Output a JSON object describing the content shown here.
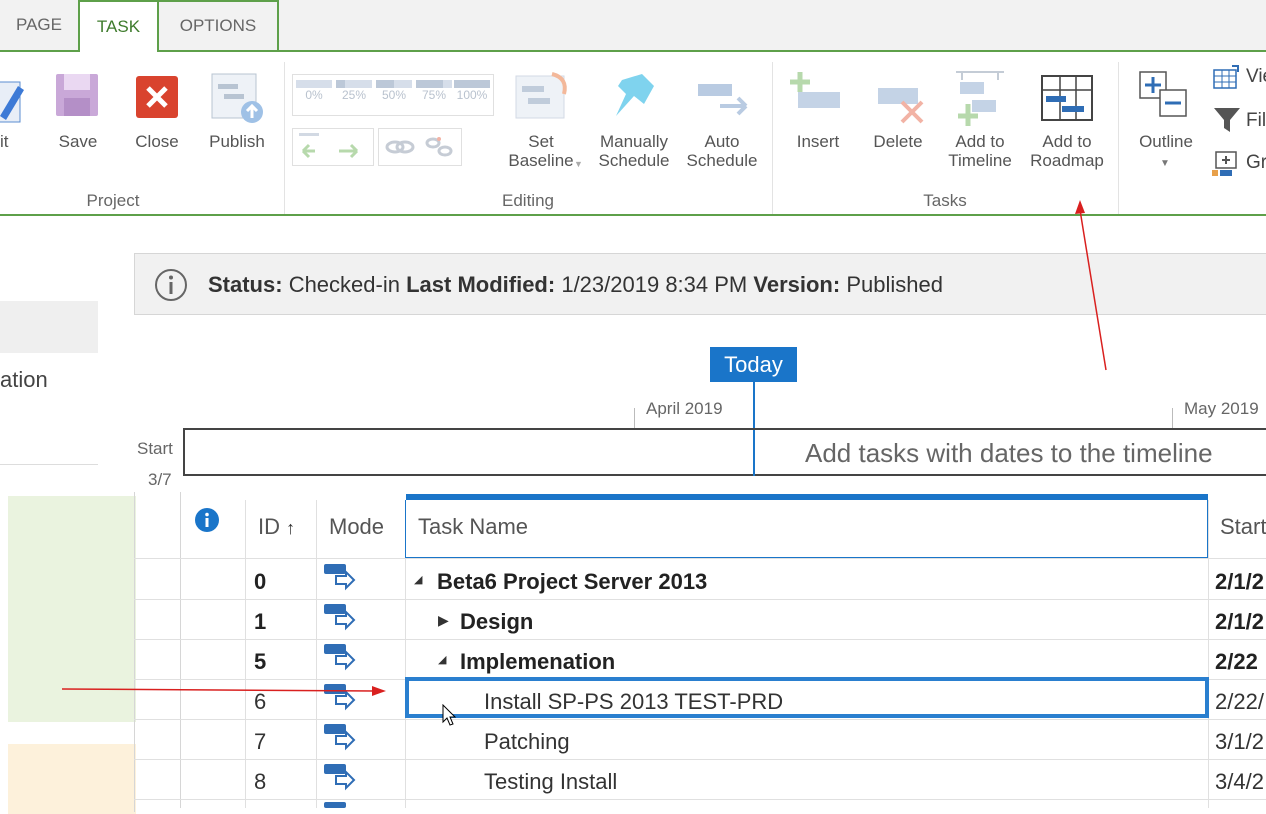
{
  "tabs": [
    {
      "label": "PAGE"
    },
    {
      "label": "TASK"
    },
    {
      "label": "OPTIONS"
    }
  ],
  "ribbon": {
    "project": {
      "edit_label": "it",
      "save_label": "Save",
      "close_label": "Close",
      "publish_label": "Publish",
      "group_label": "Project"
    },
    "editing": {
      "pct": [
        "0%",
        "25%",
        "50%",
        "75%",
        "100%"
      ],
      "set_baseline_line1": "Set",
      "set_baseline_line2": "Baseline",
      "manually_line1": "Manually",
      "manually_line2": "Schedule",
      "auto_line1": "Auto",
      "auto_line2": "Schedule",
      "group_label": "Editing"
    },
    "tasks": {
      "insert_label": "Insert",
      "delete_label": "Delete",
      "add_timeline_line1": "Add to",
      "add_timeline_line2": "Timeline",
      "add_roadmap_line1": "Add to",
      "add_roadmap_line2": "Roadmap",
      "group_label": "Tasks"
    },
    "view": {
      "outline_label": "Outline",
      "view_label": "Vie",
      "filter_label": "Fil",
      "group_label": "Gr"
    }
  },
  "left_panel": {
    "partial_text": "ation"
  },
  "status_bar": {
    "status_key": "Status:",
    "status_value": "Checked-in",
    "modified_key": "Last Modified:",
    "modified_value": "1/23/2019 8:34 PM",
    "version_key": "Version:",
    "version_value": "Published"
  },
  "timeline": {
    "today_label": "Today",
    "month1": "April 2019",
    "month2": "May 2019",
    "start_label": "Start",
    "start_date": "3/7",
    "placeholder": "Add tasks with dates to the timeline"
  },
  "grid": {
    "headers": {
      "id": "ID",
      "id_sort": "↑",
      "mode": "Mode",
      "task_name": "Task Name",
      "start": "Start"
    },
    "rows": [
      {
        "id": "0",
        "name": "Beta6 Project Server 2013",
        "start": "2/1/2",
        "expander": "◢"
      },
      {
        "id": "1",
        "name": "Design",
        "start": "2/1/2",
        "expander": "▶"
      },
      {
        "id": "5",
        "name": "Implemenation",
        "start": "2/22",
        "expander": "◢"
      },
      {
        "id": "6",
        "name": "Install SP-PS 2013 TEST-PRD",
        "start": "2/22/",
        "expander": ""
      },
      {
        "id": "7",
        "name": "Patching",
        "start": "3/1/2",
        "expander": ""
      },
      {
        "id": "8",
        "name": "Testing Install",
        "start": "3/4/2",
        "expander": ""
      }
    ]
  },
  "colors": {
    "accent_green": "#5ea04a",
    "accent_blue": "#1a75c9",
    "annotation_red": "#d9201f"
  }
}
